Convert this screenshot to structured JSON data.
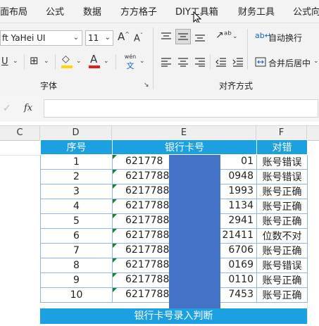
{
  "menu": {
    "items": [
      "面布局",
      "公式",
      "数据",
      "方方格子",
      "DIY工具箱",
      "财务工具",
      "公式向"
    ]
  },
  "ribbon": {
    "font_name": "ft YaHei UI",
    "font_size": "11",
    "font_group_label": "字体",
    "align_group_label": "对齐方式",
    "wrap_text_label": "自动换行",
    "merge_center_label": "合并后居中",
    "phonetic_top": "wén",
    "phonetic_bottom": "文",
    "increase_font": "A",
    "decrease_font": "A",
    "font_color_letter": "A"
  },
  "formula_bar": {
    "fx_label": "fx",
    "value": ""
  },
  "columns": [
    "C",
    "D",
    "E",
    "F"
  ],
  "table": {
    "headers": [
      "序号",
      "银行卡号",
      "对错"
    ],
    "rows": [
      {
        "n": "1",
        "pre": "621778",
        "suf": "01",
        "status": "账号错误"
      },
      {
        "n": "2",
        "pre": "6217788",
        "suf": "0948",
        "status": "账号错误"
      },
      {
        "n": "3",
        "pre": "6217788",
        "suf": "1993",
        "status": "账号正确"
      },
      {
        "n": "4",
        "pre": "6217788",
        "suf": "1134",
        "status": "账号正确"
      },
      {
        "n": "5",
        "pre": "6217788",
        "suf": "2941",
        "status": "账号正确"
      },
      {
        "n": "6",
        "pre": "62177883",
        "suf": "21411",
        "status": "位数不对"
      },
      {
        "n": "7",
        "pre": "6217788",
        "suf": "6706",
        "status": "账号正确"
      },
      {
        "n": "8",
        "pre": "6217788",
        "suf": "0169",
        "status": "账号错误"
      },
      {
        "n": "9",
        "pre": "6217788",
        "suf": "0110",
        "status": "账号正确"
      },
      {
        "n": "10",
        "pre": "6217788",
        "suf": "7453",
        "status": "账号正确"
      }
    ],
    "footer": "银行卡号录入判断"
  },
  "colors": {
    "header_bg": "#1ba1e2",
    "mask": "#4472c4",
    "font_color_bar": "#e02020",
    "fill_color_bar": "#ffd800"
  }
}
